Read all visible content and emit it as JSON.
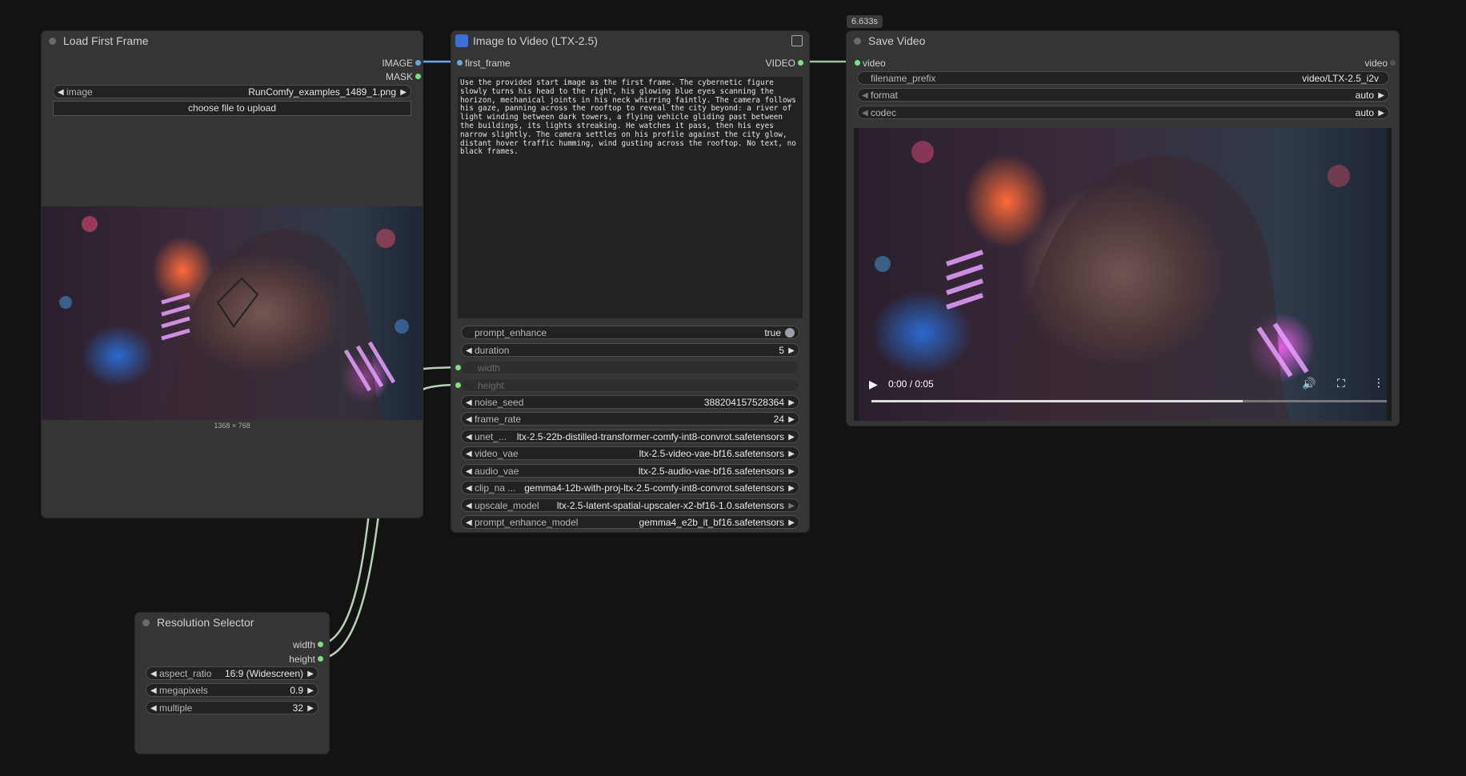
{
  "load_node": {
    "title": "Load First Frame",
    "output_image": "IMAGE",
    "output_mask": "MASK",
    "image_widget_label": "image",
    "image_widget_value": "RunComfy_examples_1489_1.png",
    "upload_label": "choose file to upload",
    "dimensions": "1368 × 768"
  },
  "i2v_node": {
    "title": "Image to Video (LTX-2.5)",
    "input_first_frame": "first_frame",
    "output_video": "VIDEO",
    "prompt": "Use the provided start image as the first frame. The cybernetic figure slowly turns his head to the right, his glowing blue eyes scanning the horizon, mechanical joints in his neck whirring faintly. The camera follows his gaze, panning across the rooftop to reveal the city beyond: a river of light winding between dark towers, a flying vehicle gliding past between the buildings, its lights streaking. He watches it pass, then his eyes narrow slightly. The camera settles on his profile against the city glow, distant hover traffic humming, wind gusting across the rooftop. No text, no black frames.",
    "widgets": [
      {
        "label": "prompt_enhance",
        "value": "true"
      },
      {
        "label": "duration",
        "value": "5"
      },
      {
        "label": "width",
        "value": ""
      },
      {
        "label": "height",
        "value": ""
      },
      {
        "label": "noise_seed",
        "value": "388204157528364"
      },
      {
        "label": "frame_rate",
        "value": "24"
      },
      {
        "label": "unet_...",
        "value": "ltx-2.5-22b-distilled-transformer-comfy-int8-convrot.safetensors"
      },
      {
        "label": "video_vae",
        "value": "ltx-2.5-video-vae-bf16.safetensors"
      },
      {
        "label": "audio_vae",
        "value": "ltx-2.5-audio-vae-bf16.safetensors"
      },
      {
        "label": "clip_na ...",
        "value": "gemma4-12b-with-proj-ltx-2.5-comfy-int8-convrot.safetensors"
      },
      {
        "label": "upscale_model",
        "value": "ltx-2.5-latent-spatial-upscaler-x2-bf16-1.0.safetensors"
      },
      {
        "label": "prompt_enhance_model",
        "value": "gemma4_e2b_it_bf16.safetensors"
      }
    ]
  },
  "save_node": {
    "badge": "6.633s",
    "title": "Save Video",
    "input_video": "video",
    "output_video": "video",
    "filename_prefix_label": "filename_prefix",
    "filename_prefix_value": "video/LTX-2.5_i2v",
    "format_label": "format",
    "format_value": "auto",
    "codec_label": "codec",
    "codec_value": "auto",
    "player_time": "0:00 / 0:05",
    "player_progress": 0.72
  },
  "res_node": {
    "title": "Resolution Selector",
    "output_width": "width",
    "output_height": "height",
    "aspect_ratio_label": "aspect_ratio",
    "aspect_ratio_value": "16:9 (Widescreen)",
    "megapixels_label": "megapixels",
    "megapixels_value": "0.9",
    "multiple_label": "multiple",
    "multiple_value": "32"
  },
  "colors": {
    "image_link": "#6aa7e8",
    "video_link": "#9fc3a0",
    "int_link": "#b7d0b8",
    "slot_green": "#7ee07e",
    "slot_blue": "#6aa7e8"
  }
}
